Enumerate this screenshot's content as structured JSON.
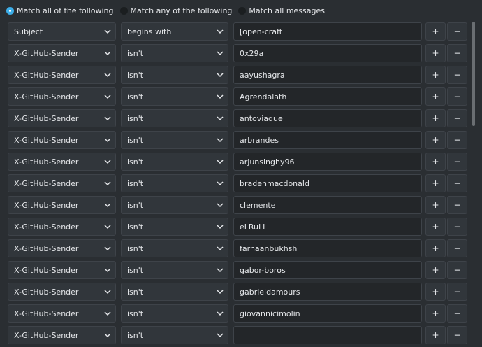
{
  "match_options": [
    {
      "label": "Match all of the following",
      "checked": true
    },
    {
      "label": "Match any of the following",
      "checked": false
    },
    {
      "label": "Match all messages",
      "checked": false
    }
  ],
  "add_label": "+",
  "remove_label": "−",
  "rules": [
    {
      "field": "Subject",
      "operator": "begins with",
      "value": "[open-craft"
    },
    {
      "field": "X-GitHub-Sender",
      "operator": "isn't",
      "value": "0x29a"
    },
    {
      "field": "X-GitHub-Sender",
      "operator": "isn't",
      "value": "aayushagra"
    },
    {
      "field": "X-GitHub-Sender",
      "operator": "isn't",
      "value": "Agrendalath"
    },
    {
      "field": "X-GitHub-Sender",
      "operator": "isn't",
      "value": "antoviaque"
    },
    {
      "field": "X-GitHub-Sender",
      "operator": "isn't",
      "value": "arbrandes"
    },
    {
      "field": "X-GitHub-Sender",
      "operator": "isn't",
      "value": "arjunsinghy96"
    },
    {
      "field": "X-GitHub-Sender",
      "operator": "isn't",
      "value": "bradenmacdonald"
    },
    {
      "field": "X-GitHub-Sender",
      "operator": "isn't",
      "value": "clemente"
    },
    {
      "field": "X-GitHub-Sender",
      "operator": "isn't",
      "value": "eLRuLL"
    },
    {
      "field": "X-GitHub-Sender",
      "operator": "isn't",
      "value": "farhaanbukhsh"
    },
    {
      "field": "X-GitHub-Sender",
      "operator": "isn't",
      "value": "gabor-boros"
    },
    {
      "field": "X-GitHub-Sender",
      "operator": "isn't",
      "value": "gabrieldamours"
    },
    {
      "field": "X-GitHub-Sender",
      "operator": "isn't",
      "value": "giovannicimolin"
    },
    {
      "field": "X-GitHub-Sender",
      "operator": "isn't",
      "value": ""
    }
  ]
}
